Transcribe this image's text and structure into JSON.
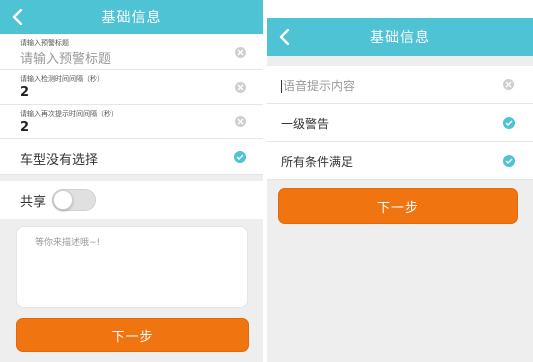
{
  "left": {
    "header": {
      "title": "基础信息"
    },
    "fields": [
      {
        "label": "请输入预警标题",
        "placeholder": "请输入预警标题",
        "value": ""
      },
      {
        "label": "请输入检测时间间隔（秒）",
        "value": "2"
      },
      {
        "label": "请输入再次提示时间间隔（秒）",
        "value": "2"
      }
    ],
    "vehicle_select": {
      "text": "车型没有选择"
    },
    "share": {
      "label": "共享",
      "enabled": false
    },
    "description": {
      "placeholder": "等你来描述哦~!"
    },
    "next_button": {
      "label": "下一步"
    }
  },
  "right": {
    "header": {
      "title": "基础信息"
    },
    "voice_field": {
      "placeholder": "语音提示内容",
      "value": ""
    },
    "alert_level": {
      "text": "一级警告"
    },
    "condition": {
      "text": "所有条件满足"
    },
    "next_button": {
      "label": "下一步"
    }
  },
  "colors": {
    "header": "#4dc3d4",
    "button": "#f07511",
    "check": "#4dc3d4",
    "clear": "#cfcfcf",
    "background": "#eeeeee"
  },
  "icons": [
    "back-arrow-icon",
    "clear-icon",
    "check-circle-icon"
  ]
}
